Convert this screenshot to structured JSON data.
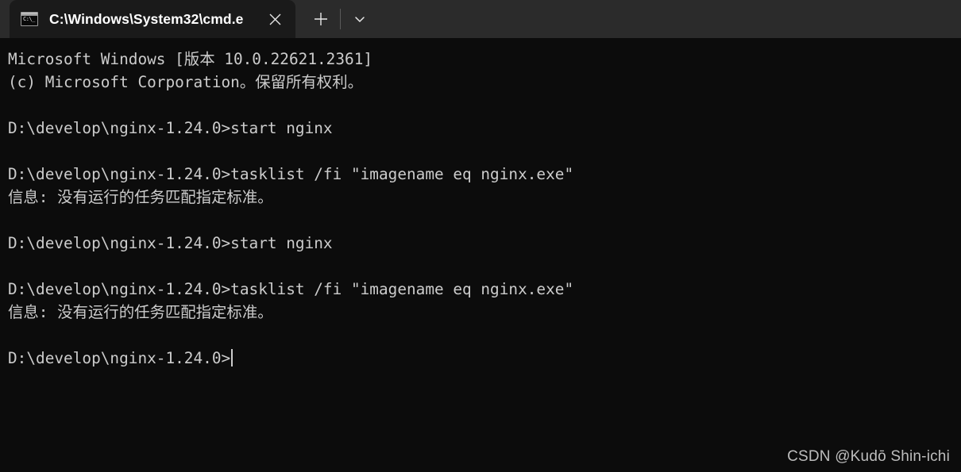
{
  "window": {
    "background_color": "#0c0c0c",
    "tabstrip_color": "#2b2b2b",
    "tab_color": "#1a1a1a",
    "text_color": "#cccccc"
  },
  "tabstrip": {
    "tab": {
      "icon_name": "console-window-icon",
      "title": "C:\\Windows\\System32\\cmd.e",
      "close_label": "✕"
    },
    "new_tab_label": "+",
    "dropdown_label": "⌄"
  },
  "terminal": {
    "lines": [
      {
        "text": "Microsoft Windows [版本 10.0.22621.2361]",
        "kind": "output"
      },
      {
        "text": "(c) Microsoft Corporation。保留所有权利。",
        "kind": "output"
      },
      {
        "text": "",
        "kind": "blank"
      },
      {
        "text": "D:\\develop\\nginx-1.24.0>start nginx",
        "kind": "prompt"
      },
      {
        "text": "",
        "kind": "blank"
      },
      {
        "text": "D:\\develop\\nginx-1.24.0>tasklist /fi \"imagename eq nginx.exe\"",
        "kind": "prompt"
      },
      {
        "text": "信息: 没有运行的任务匹配指定标准。",
        "kind": "output"
      },
      {
        "text": "",
        "kind": "blank"
      },
      {
        "text": "D:\\develop\\nginx-1.24.0>start nginx",
        "kind": "prompt"
      },
      {
        "text": "",
        "kind": "blank"
      },
      {
        "text": "D:\\develop\\nginx-1.24.0>tasklist /fi \"imagename eq nginx.exe\"",
        "kind": "prompt"
      },
      {
        "text": "信息: 没有运行的任务匹配指定标准。",
        "kind": "output"
      },
      {
        "text": "",
        "kind": "blank"
      }
    ],
    "final_prompt": "D:\\develop\\nginx-1.24.0>"
  },
  "watermark": {
    "text": "CSDN @Kudō Shin-ichi"
  }
}
